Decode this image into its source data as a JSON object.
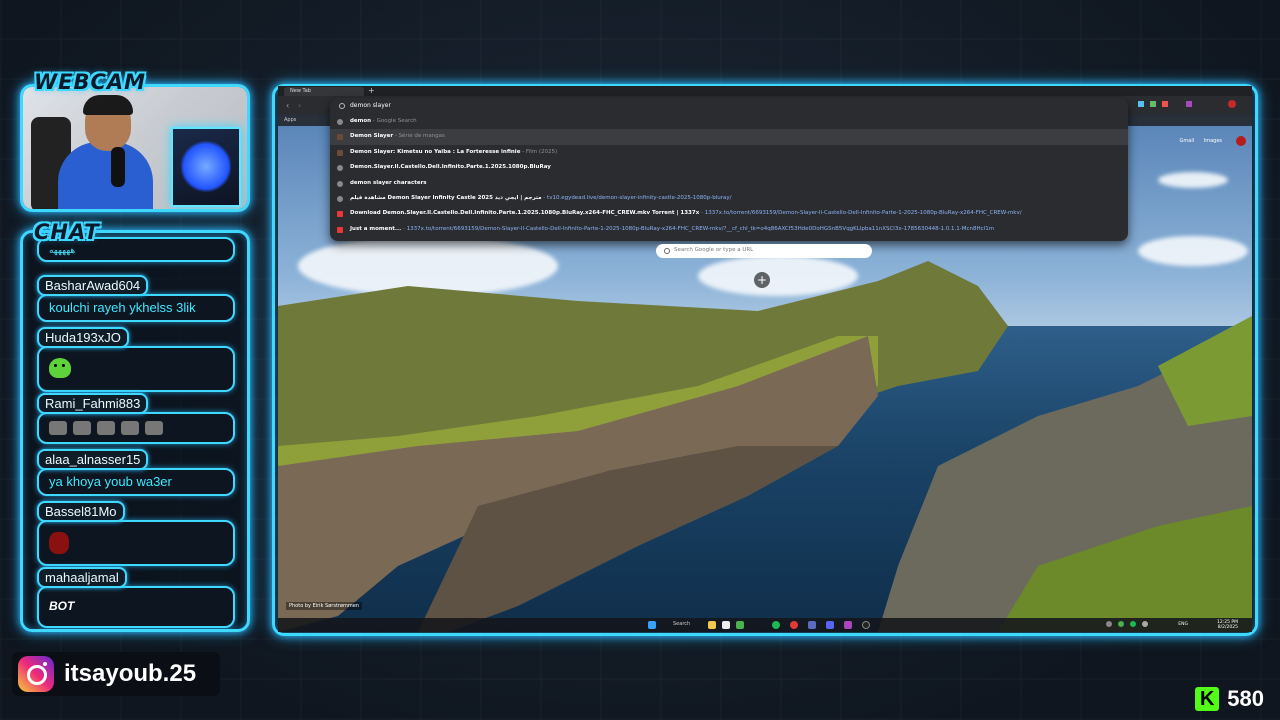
{
  "overlay": {
    "webcam_title": "WEBCAM",
    "chat_title": "CHAT",
    "instagram_handle": "itsayoub.25",
    "kick_icon": "K",
    "viewer_count": "580"
  },
  "chat": {
    "partial_top": "هههههه",
    "messages": [
      {
        "user": "BasharAwad604",
        "text": "koulchi rayeh ykhelss 3lik",
        "kind": "text"
      },
      {
        "user": "Huda193xJO",
        "text": "",
        "kind": "emote-green"
      },
      {
        "user": "Rami_Fahmi883",
        "text": "",
        "kind": "emote-row"
      },
      {
        "user": "alaa_alnasser15",
        "text": "ya khoya youb wa3er",
        "kind": "text"
      },
      {
        "user": "Bassel81Mo",
        "text": "",
        "kind": "emote-red"
      },
      {
        "user": "mahaaljamal",
        "text": "BOT",
        "kind": "bot"
      }
    ]
  },
  "browser": {
    "tab_title": "New Tab",
    "bookmarks_label": "Apps",
    "omnibox_text": "demon slayer",
    "suggestions": [
      {
        "main": "demon",
        "rest": " - Google Search",
        "url": "",
        "icon": "search-icon"
      },
      {
        "main": "Demon Slayer",
        "rest": " - Série de mangas",
        "url": "",
        "icon": "image-thumb"
      },
      {
        "main": "Demon Slayer: Kimetsu no Yaiba : La Forteresse infinie",
        "rest": " - Film (2025)",
        "url": "",
        "icon": "image-thumb"
      },
      {
        "main": "Demon.Slayer.Il.Castello.Dell.Infinito.Parte.1.2025.1080p.BluRay",
        "rest": "",
        "url": "",
        "icon": "search-icon"
      },
      {
        "main": "demon slayer characters",
        "rest": "",
        "url": "",
        "icon": "search-icon"
      },
      {
        "main": "مشاهدة فيلم Demon Slayer Infinity Castle 2025 مترجم | ايجي ديد",
        "rest": " - ",
        "url": "tv10.egydead.live/demon-slayer-infinity-castle-2025-1080p-bluray/",
        "icon": "globe-icon"
      },
      {
        "main": "Download Demon.Slayer.Il.Castello.Dell.Infinito.Parte.1.2025.1080p.BluRay.x264-FHC_CREW.mkv Torrent | 1337x",
        "rest": " - ",
        "url": "1337x.to/torrent/6693159/Demon-Slayer-Il-Castello-Dell-Infinito-Parte-1-2025-1080p-BluRay-x264-FHC_CREW-mkv/",
        "icon": "x-icon"
      },
      {
        "main": "Just a moment...",
        "rest": " - ",
        "url": "1337x.to/torrent/6693159/Demon-Slayer-Il-Castello-Dell-Infinito-Parte-1-2025-1080p-BluRay-x264-FHC_CREW-mkv/?__cf_chl_tk=o4q86AXCf53Hde0DoHGSnB5VqgKLlpba11nXSCl3x-1785630448-1.0.1.1-Mcn8Hcl1m",
        "icon": "x-icon"
      }
    ],
    "newtab_search_placeholder": "Search Google or type a URL",
    "top_links": [
      "Gmail",
      "Images"
    ],
    "photo_credit": "Photo by Eirik Sørstrømmen",
    "taskbar_search": "Search",
    "clock_time": "12:25 PM",
    "clock_date": "8/2/2025",
    "lang": "ENG"
  }
}
